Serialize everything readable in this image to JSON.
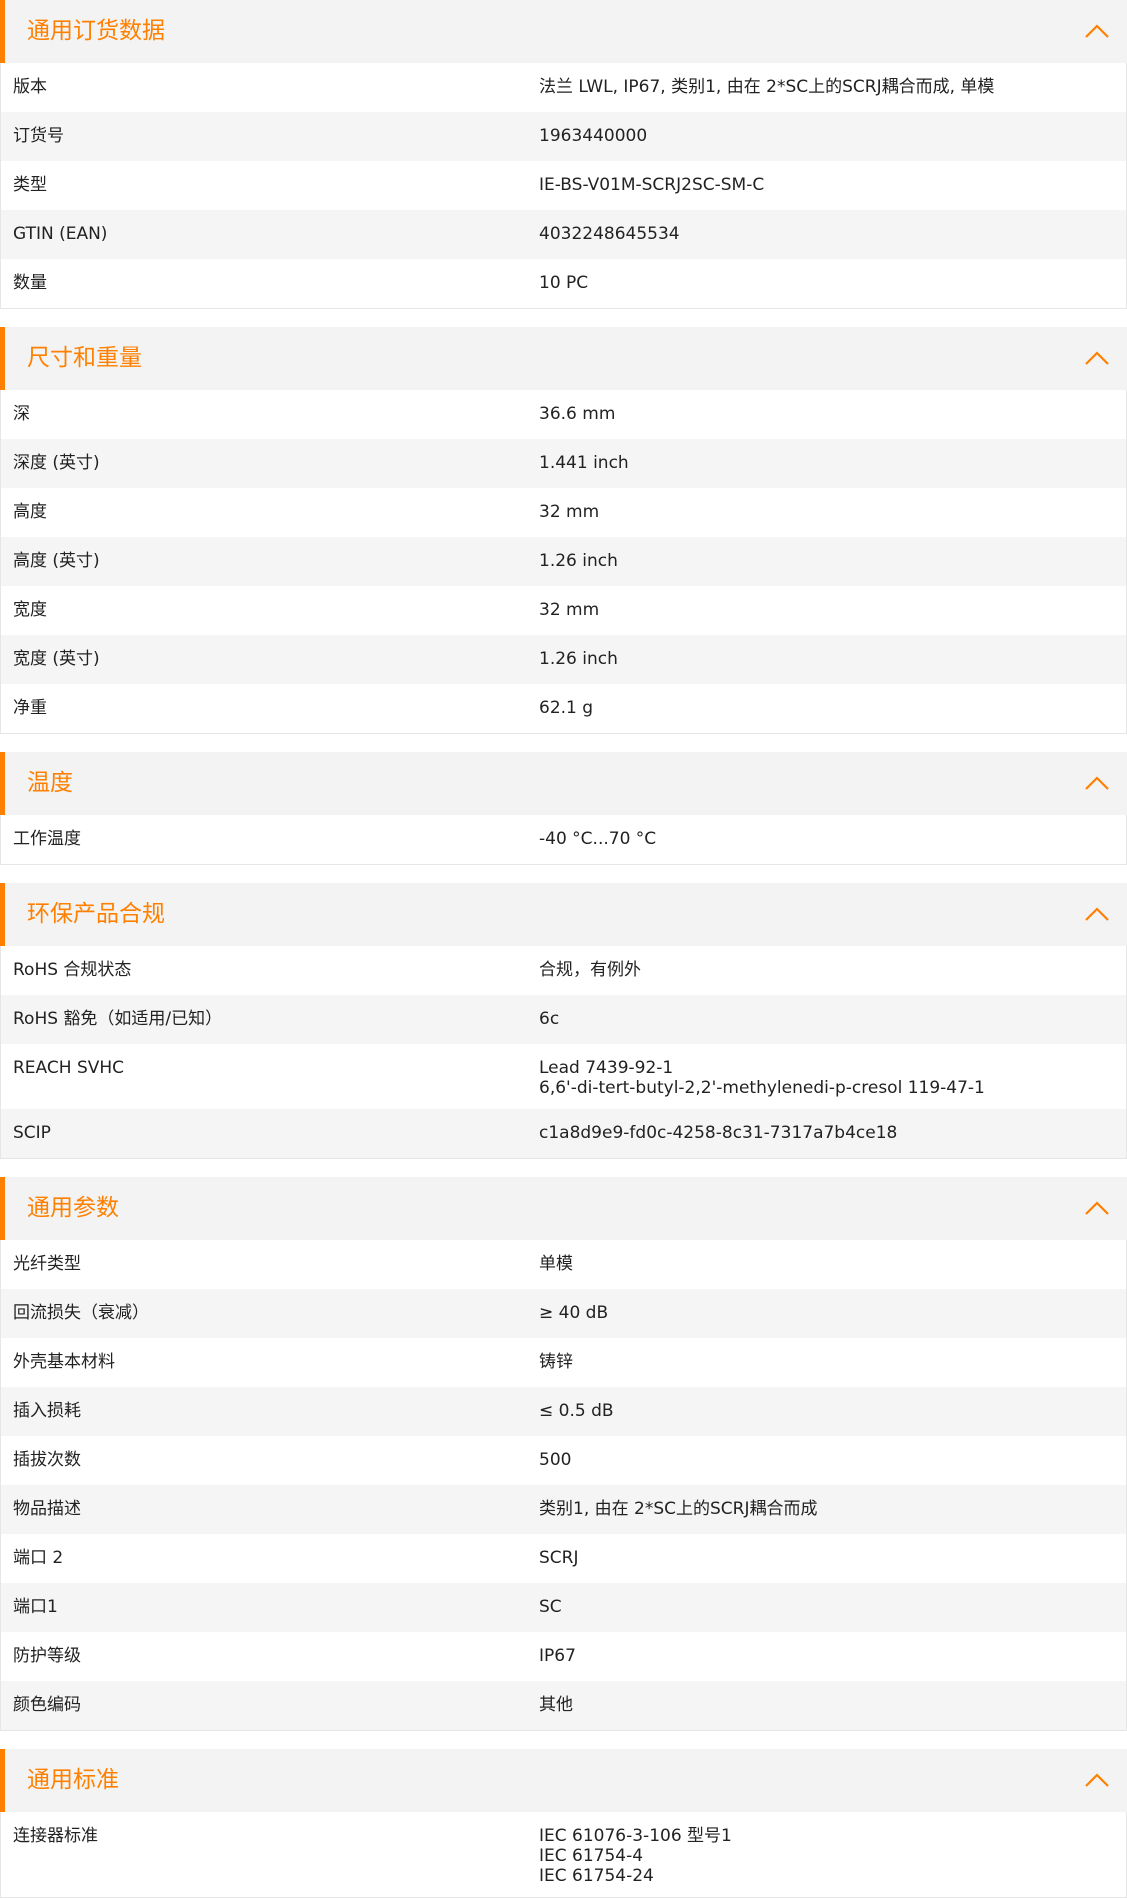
{
  "sections": [
    {
      "title": "通用订货数据",
      "rows": [
        {
          "label": "版本",
          "value": "法兰 LWL, IP67, 类别1, 由在 2*SC上的SCRJ耦合而成, 单模"
        },
        {
          "label": "订货号",
          "value": "1963440000"
        },
        {
          "label": "类型",
          "value": "IE-BS-V01M-SCRJ2SC-SM-C"
        },
        {
          "label": "GTIN (EAN)",
          "value": "4032248645534"
        },
        {
          "label": "数量",
          "value": "10  PC"
        }
      ]
    },
    {
      "title": "尺寸和重量",
      "rows": [
        {
          "label": "深",
          "value": "36.6  mm"
        },
        {
          "label": "深度 (英寸)",
          "value": "1.441  inch"
        },
        {
          "label": "高度",
          "value": "32  mm"
        },
        {
          "label": "高度 (英寸)",
          "value": "1.26  inch"
        },
        {
          "label": "宽度",
          "value": "32  mm"
        },
        {
          "label": "宽度 (英寸)",
          "value": "1.26  inch"
        },
        {
          "label": "净重",
          "value": "62.1  g"
        }
      ]
    },
    {
      "title": "温度",
      "rows": [
        {
          "label": "工作温度",
          "value": "-40 °C...70 °C"
        }
      ]
    },
    {
      "title": "环保产品合规",
      "rows": [
        {
          "label": "RoHS 合规状态",
          "value": "合规，有例外"
        },
        {
          "label": "RoHS 豁免（如适用/已知）",
          "value": "6c"
        },
        {
          "label": "REACH SVHC",
          "value": "Lead 7439-92-1\n6,6'-di-tert-butyl-2,2'-methylenedi-p-cresol 119-47-1"
        },
        {
          "label": "SCIP",
          "value": "c1a8d9e9-fd0c-4258-8c31-7317a7b4ce18"
        }
      ]
    },
    {
      "title": "通用参数",
      "rows": [
        {
          "label": "光纤类型",
          "value": "单模"
        },
        {
          "label": "回流损失（衰减）",
          "value": "≥ 40 dB"
        },
        {
          "label": "外壳基本材料",
          "value": "铸锌"
        },
        {
          "label": "插入损耗",
          "value": "≤ 0.5 dB"
        },
        {
          "label": "插拔次数",
          "value": "500"
        },
        {
          "label": "物品描述",
          "value": "类别1, 由在 2*SC上的SCRJ耦合而成"
        },
        {
          "label": "端口 2",
          "value": "SCRJ"
        },
        {
          "label": "端口1",
          "value": "SC"
        },
        {
          "label": "防护等级",
          "value": "IP67"
        },
        {
          "label": "颜色编码",
          "value": "其他"
        }
      ]
    },
    {
      "title": "通用标准",
      "rows": [
        {
          "label": "连接器标准",
          "value": "IEC 61076-3-106 型号1\nIEC 61754-4\nIEC 61754-24"
        }
      ]
    }
  ],
  "icons": {
    "collapse": "chevron-up-icon"
  },
  "colors": {
    "accent": "#ff8000",
    "header_bg": "#f3f3f3",
    "row_alt_bg": "#f5f5f5",
    "border": "#e6e6e6"
  }
}
